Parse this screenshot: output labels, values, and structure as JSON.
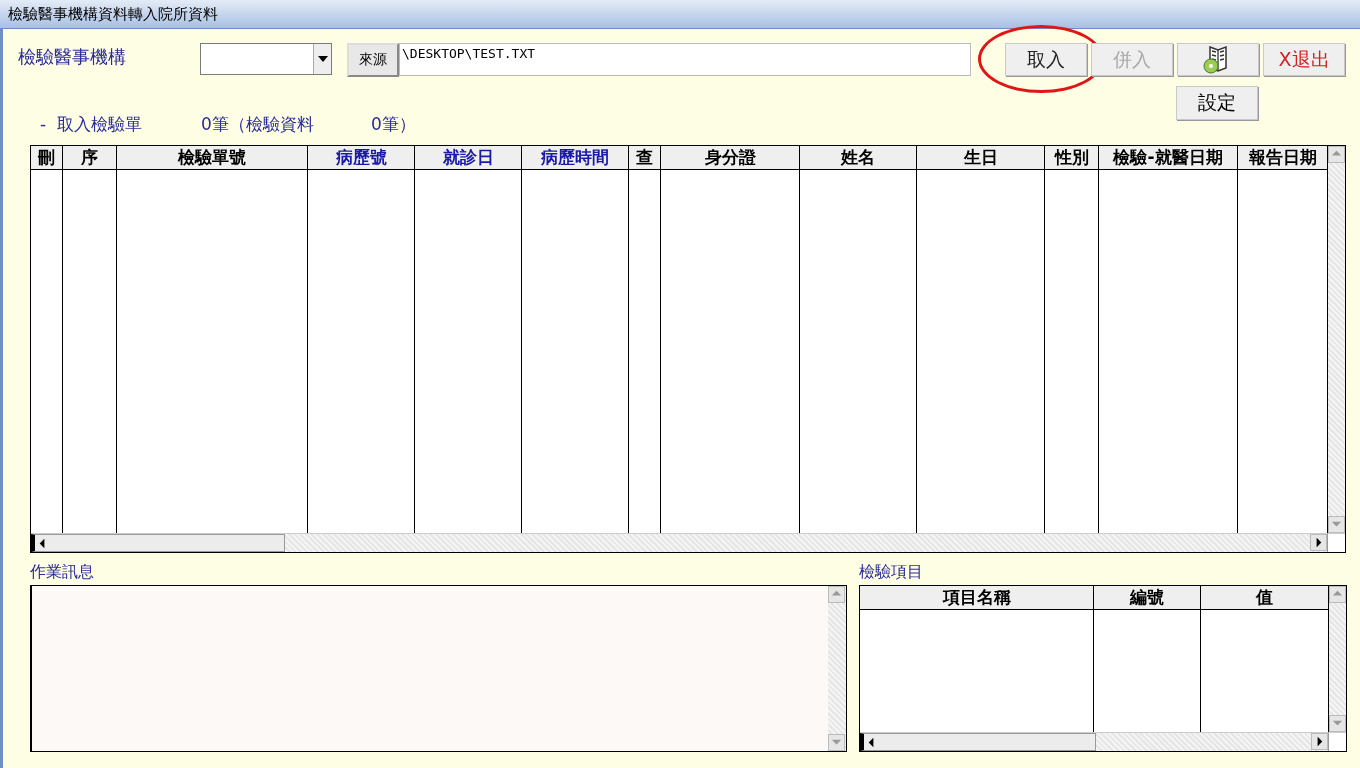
{
  "window": {
    "title": "檢驗醫事機構資料轉入院所資料"
  },
  "source_bar": {
    "label": "檢驗醫事機構",
    "source_button": "來源",
    "path": "\\DESKTOP\\TEST.TXT"
  },
  "buttons": [
    {
      "kind": "text",
      "label": "取入",
      "disabled": false,
      "highlighted": true
    },
    {
      "kind": "text",
      "label": "併入",
      "disabled": true,
      "highlighted": false
    },
    {
      "kind": "icon",
      "disabled": false,
      "highlighted": false
    },
    {
      "kind": "exit",
      "label": "X退出",
      "disabled": false,
      "highlighted": false
    }
  ],
  "settings_button": "設定",
  "summary": [
    "-  取入檢驗單",
    "0筆（檢驗資料",
    "0筆）"
  ],
  "records_table": {
    "columns": [
      {
        "label": "刪",
        "color": "#000000"
      },
      {
        "label": "序",
        "color": "#000000"
      },
      {
        "label": "檢驗單號",
        "color": "#000000"
      },
      {
        "label": "病歷號",
        "color": "#1a1aa6"
      },
      {
        "label": "就診日",
        "color": "#1a1aa6"
      },
      {
        "label": "病歷時間",
        "color": "#1a1aa6"
      },
      {
        "label": "查",
        "color": "#000000"
      },
      {
        "label": "身分證",
        "color": "#000000"
      },
      {
        "label": "姓名",
        "color": "#000000"
      },
      {
        "label": "生日",
        "color": "#000000"
      },
      {
        "label": "性別",
        "color": "#000000"
      },
      {
        "label": "檢驗-就醫日期",
        "color": "#000000"
      },
      {
        "label": "報告日期",
        "color": "#000000"
      }
    ]
  },
  "message_panel": {
    "label": "作業訊息"
  },
  "items_panel": {
    "label": "檢驗項目",
    "columns": [
      {
        "label": "項目名稱",
        "color": "#000000"
      },
      {
        "label": "編號",
        "color": "#000000"
      },
      {
        "label": "值",
        "color": "#000000"
      }
    ]
  }
}
